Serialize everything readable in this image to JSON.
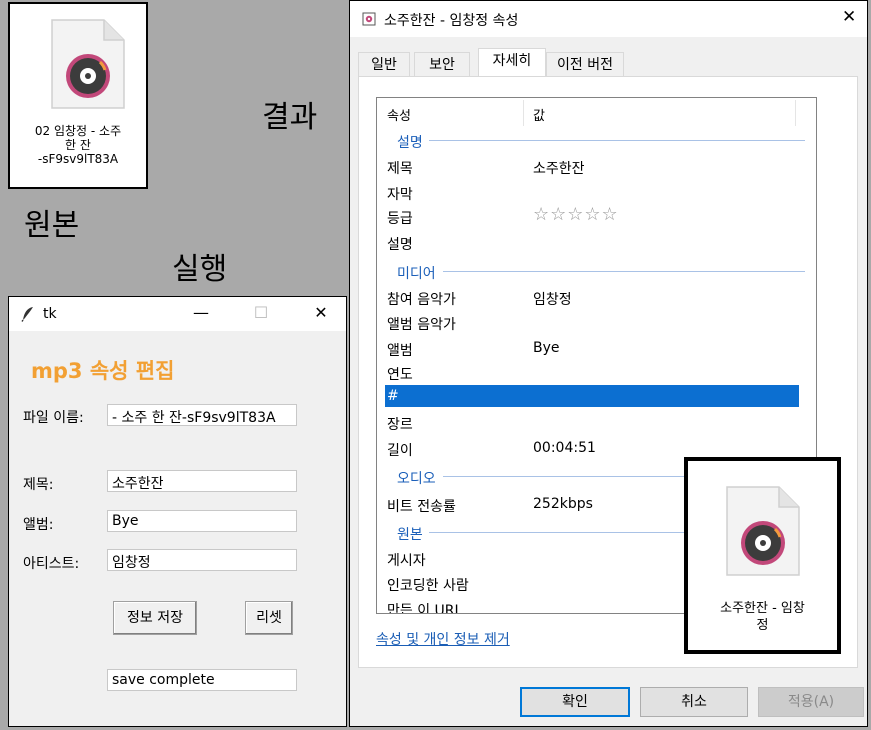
{
  "original_file": {
    "caption_lines": [
      "02 임창정 - 소주",
      "한 잔",
      "-sF9sv9lT83A"
    ]
  },
  "labels": {
    "original": "원본",
    "run": "실행",
    "result": "결과"
  },
  "tk_window": {
    "title": "tk",
    "controls": {
      "minimize": "—",
      "maximize": "☐",
      "close": "✕"
    },
    "heading": "mp3 속성 편집",
    "filename_label": "파일 이름:",
    "filename_value": "- 소주 한 잔-sF9sv9lT83A",
    "title_label": "제목:",
    "title_value": "소주한잔",
    "album_label": "앨범:",
    "album_value": "Bye",
    "artist_label": "아티스트:",
    "artist_value": "임창정",
    "save_button": "정보 저장",
    "reset_button": "리셋",
    "status_value": "save complete"
  },
  "dialog": {
    "title": "소주한잔 - 임창정 속성",
    "close": "✕",
    "tabs": [
      "일반",
      "보안",
      "자세히",
      "이전 버전"
    ],
    "active_tab": "자세히",
    "columns": {
      "property": "속성",
      "value": "값"
    },
    "groups": {
      "description": "설명",
      "media": "미디어",
      "audio": "오디오",
      "origin": "원본"
    },
    "rows": {
      "title": {
        "name": "제목",
        "value": "소주한잔"
      },
      "subtitle": {
        "name": "자막",
        "value": ""
      },
      "rating": {
        "name": "등급",
        "value": "☆☆☆☆☆"
      },
      "comment": {
        "name": "설명",
        "value": ""
      },
      "contributing_artist": {
        "name": "참여 음악가",
        "value": "임창정"
      },
      "album_artist": {
        "name": "앨범 음악가",
        "value": ""
      },
      "album": {
        "name": "앨범",
        "value": "Bye"
      },
      "year": {
        "name": "연도",
        "value": ""
      },
      "track": {
        "name": "#",
        "value": ""
      },
      "genre": {
        "name": "장르",
        "value": ""
      },
      "length": {
        "name": "길이",
        "value": "00:04:51"
      },
      "bitrate": {
        "name": "비트 전송률",
        "value": "252kbps"
      },
      "publisher": {
        "name": "게시자",
        "value": ""
      },
      "encoded_by": {
        "name": "인코딩한 사람",
        "value": ""
      },
      "author_url": {
        "name": "만든 이 URL",
        "value": ""
      }
    },
    "remove_link": "속성 및 개인 정보 제거",
    "buttons": {
      "ok": "확인",
      "cancel": "취소",
      "apply": "적용(A)"
    }
  },
  "result_file": {
    "caption_lines": [
      "소주한잔 - 임창",
      "정"
    ]
  },
  "colors": {
    "accent_orange": "#f2a033",
    "selection_blue": "#0c6fd1",
    "group_blue": "#1b5fb9",
    "link_blue": "#1a5db5"
  }
}
